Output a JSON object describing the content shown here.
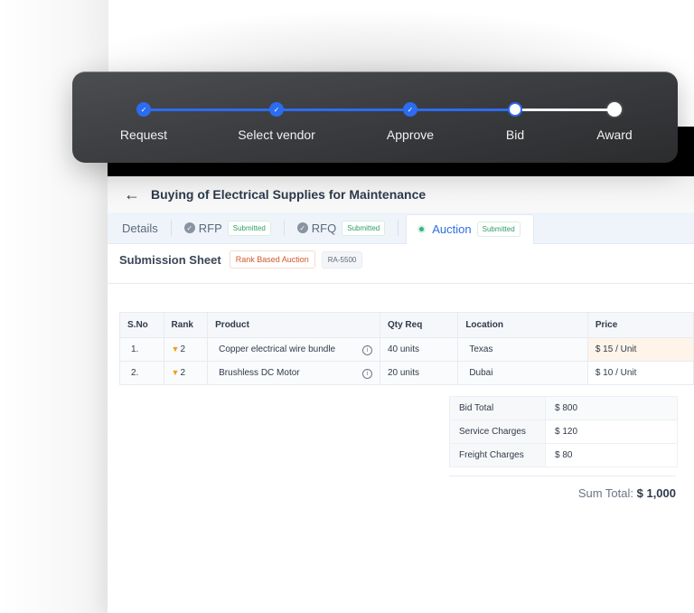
{
  "stepper": {
    "steps": [
      {
        "label": "Request",
        "status": "done"
      },
      {
        "label": "Select vendor",
        "status": "done"
      },
      {
        "label": "Approve",
        "status": "done"
      },
      {
        "label": "Bid",
        "status": "current"
      },
      {
        "label": "Award",
        "status": "pending"
      }
    ],
    "check_glyph": "✓",
    "accent_color": "#2c6cf0"
  },
  "header": {
    "back_icon": "←",
    "title": "Buying of Electrical Supplies for Maintenance"
  },
  "tabs": [
    {
      "label": "Details"
    },
    {
      "label": "RFP",
      "badge": "Submitted",
      "icon": "check-circle-icon"
    },
    {
      "label": "RFQ",
      "badge": "Submitted",
      "icon": "check-circle-icon"
    },
    {
      "label": "Auction",
      "badge": "Submitted",
      "icon": "status-dot-icon",
      "active": true
    }
  ],
  "sheet": {
    "title": "Submission Sheet",
    "auction_type": "Rank Based Auction",
    "reference": "RA-5500"
  },
  "items_table": {
    "columns": [
      "S.No",
      "Rank",
      "Product",
      "Qty Req",
      "Location",
      "Price"
    ],
    "rows": [
      {
        "sno": "1.",
        "rank": "2",
        "product": "Copper electrical wire bundle",
        "qty": "40 units",
        "location": "Texas",
        "price": "$ 15 / Unit"
      },
      {
        "sno": "2.",
        "rank": "2",
        "product": "Brushless DC Motor",
        "qty": "20 units",
        "location": "Dubai",
        "price": "$ 10 / Unit"
      }
    ],
    "trophy_glyph": "🏆",
    "info_glyph": "i"
  },
  "summary": {
    "rows": [
      {
        "label": "Bid Total",
        "value": "$ 800"
      },
      {
        "label": "Service Charges",
        "value": "$ 120"
      },
      {
        "label": "Freight Charges",
        "value": "$ 80"
      }
    ],
    "sum_total_label": "Sum Total:",
    "sum_total_value": "$ 1,000"
  }
}
